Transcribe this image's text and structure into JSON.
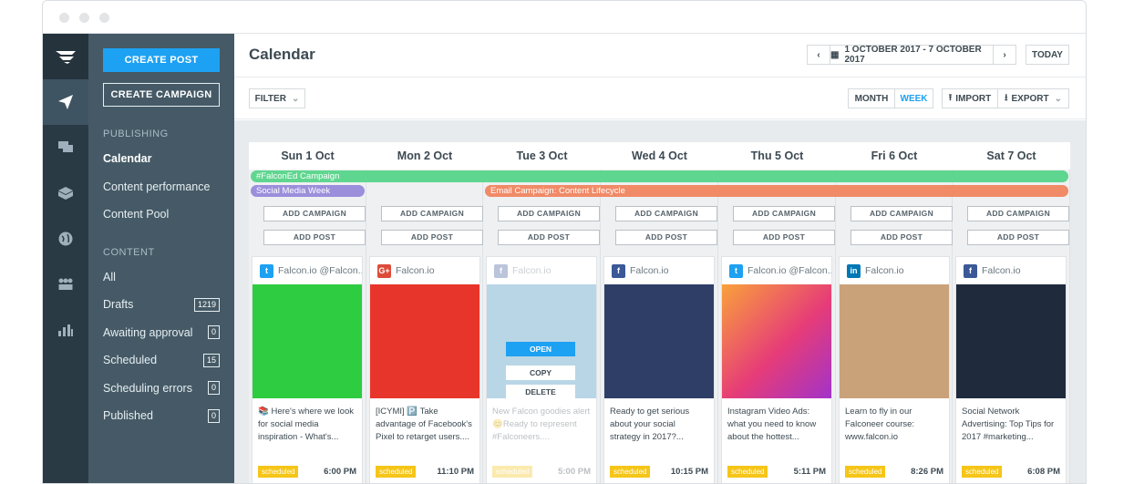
{
  "rail": {
    "icons": [
      "falcon-logo-icon",
      "paper-plane-icon",
      "chat-icon",
      "box-icon",
      "globe-icon",
      "people-icon",
      "bar-chart-icon"
    ]
  },
  "sidebar": {
    "create_post": "CREATE POST",
    "create_campaign": "CREATE CAMPAIGN",
    "publishing_head": "PUBLISHING",
    "publishing": [
      "Calendar",
      "Content performance",
      "Content Pool"
    ],
    "content_head": "CONTENT",
    "content": [
      {
        "label": "All",
        "count": null
      },
      {
        "label": "Drafts",
        "count": "1219"
      },
      {
        "label": "Awaiting approval",
        "count": "0"
      },
      {
        "label": "Scheduled",
        "count": "15"
      },
      {
        "label": "Scheduling errors",
        "count": "0"
      },
      {
        "label": "Published",
        "count": "0"
      }
    ]
  },
  "header": {
    "title": "Calendar",
    "date_range": "1 OCTOBER 2017 - 7 OCTOBER 2017",
    "today": "TODAY"
  },
  "toolbar": {
    "filter": "FILTER",
    "month": "MONTH",
    "week": "WEEK",
    "import": "IMPORT",
    "export": "EXPORT"
  },
  "calendar": {
    "days": [
      "Sun 1 Oct",
      "Mon 2 Oct",
      "Tue 3 Oct",
      "Wed 4 Oct",
      "Thu 5 Oct",
      "Fri 6 Oct",
      "Sat 7 Oct"
    ],
    "campaigns": [
      {
        "label": "#FalconEd Campaign",
        "color": "#5fd68f"
      },
      {
        "label": "Social Media Week",
        "color": "#9b8fdc"
      },
      {
        "label": "Email Campaign: Content Lifecycle",
        "color": "#f08a67"
      }
    ],
    "add_campaign": "ADD CAMPAIGN",
    "add_post": "ADD POST",
    "menu": [
      "OPEN",
      "COPY",
      "DELETE"
    ],
    "posts": [
      {
        "network": "twitter",
        "account": "Falcon.io @Falcon...",
        "text": "📚 Here's where we look for social media inspiration - What's...",
        "status": "scheduled",
        "time": "6:00 PM"
      },
      {
        "network": "googleplus",
        "account": "Falcon.io",
        "text": "[ICYMI] 🅿️ Take advantage of Facebook's Pixel to retarget users....",
        "status": "scheduled",
        "time": "11:10 PM"
      },
      {
        "network": "facebook",
        "account": "Falcon.io",
        "text": "New Falcon goodies alert 😊Ready to represent #Falconeers....",
        "status": "scheduled",
        "time": "5:00 PM"
      },
      {
        "network": "facebook",
        "account": "Falcon.io",
        "text": "Ready to get serious about your social strategy in 2017?...",
        "status": "scheduled",
        "time": "10:15 PM"
      },
      {
        "network": "twitter",
        "account": "Falcon.io @Falcon...",
        "text": "Instagram Video Ads: what you need to know about the hottest...",
        "status": "scheduled",
        "time": "5:11 PM"
      },
      {
        "network": "linkedin",
        "account": "Falcon.io",
        "text": "Learn to fly in our Falconeer course: www.falcon.io",
        "status": "scheduled",
        "time": "8:26 PM"
      },
      {
        "network": "facebook",
        "account": "Falcon.io",
        "text": "Social Network Advertising: Top Tips for 2017 #marketing...",
        "status": "scheduled",
        "time": "6:08 PM"
      }
    ]
  },
  "colors": {
    "accent": "#1da1f2",
    "sidebar": "#455a66",
    "rail": "#2a3a44",
    "badge": "#f5c518"
  }
}
